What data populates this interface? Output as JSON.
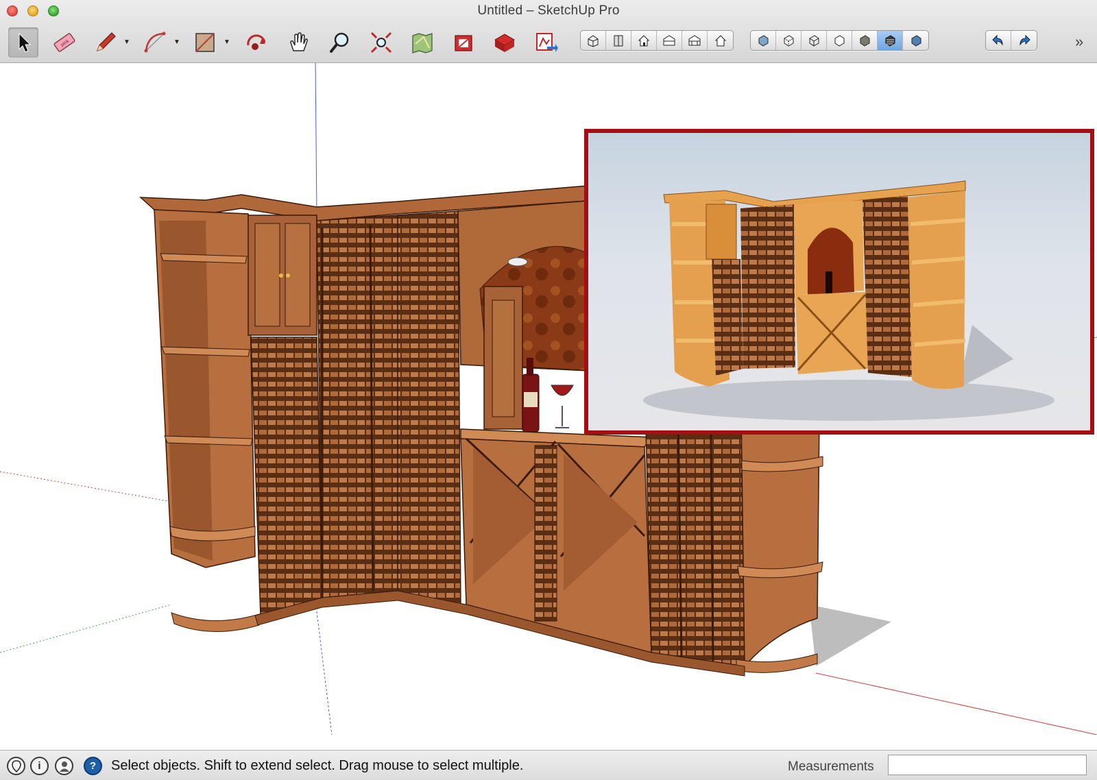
{
  "window": {
    "title": "Untitled – SketchUp Pro"
  },
  "toolbar": {
    "tools": [
      {
        "name": "select-tool",
        "icon": "arrow-cursor-icon",
        "selected": true
      },
      {
        "name": "eraser-tool",
        "icon": "eraser-icon"
      },
      {
        "name": "line-tool",
        "icon": "pencil-icon",
        "has_dropdown": true
      },
      {
        "name": "arc-tool",
        "icon": "arc-icon",
        "has_dropdown": true
      },
      {
        "name": "rectangle-tool",
        "icon": "rectangle-icon",
        "has_dropdown": true
      },
      {
        "name": "orbit-tool",
        "icon": "orbit-icon"
      },
      {
        "name": "pan-tool",
        "icon": "hand-icon"
      },
      {
        "name": "zoom-tool",
        "icon": "magnifier-icon"
      },
      {
        "name": "zoom-extents-tool",
        "icon": "zoom-extents-icon"
      },
      {
        "name": "add-location-tool",
        "icon": "map-icon"
      },
      {
        "name": "3d-warehouse-tool",
        "icon": "warehouse-icon"
      },
      {
        "name": "extension-warehouse-tool",
        "icon": "extension-warehouse-icon"
      },
      {
        "name": "send-to-layout-tool",
        "icon": "layout-icon"
      }
    ],
    "eraser_text": "pink",
    "standard_views": [
      "iso-view-icon",
      "top-view-icon",
      "front-view-icon",
      "right-view-icon",
      "back-view-icon",
      "left-view-icon"
    ],
    "face_styles": [
      "xray-icon",
      "back-edges-icon",
      "wireframe-icon",
      "hidden-line-icon",
      "shaded-icon",
      "shaded-textures-icon",
      "monochrome-icon"
    ],
    "active_face_style": "shaded-textures-icon",
    "history": [
      "undo-icon",
      "redo-icon"
    ],
    "overflow": "»"
  },
  "status_bar": {
    "icons": [
      "geo-location-icon",
      "credits-icon",
      "user-icon",
      "help-icon"
    ],
    "help_glyph": "?",
    "credits_glyph": "i",
    "message": "Select objects. Shift to extend select. Drag mouse to select multiple.",
    "measurements_label": "Measurements",
    "measurements_value": ""
  },
  "colors": {
    "wood": "#a8643a",
    "wood_dark": "#6e3a1c",
    "inset_border": "#a30f12",
    "active_style": "#6ea7e2",
    "axis_red": "#d43c3c",
    "axis_green": "#3aa94a",
    "axis_blue": "#4a5de0"
  }
}
